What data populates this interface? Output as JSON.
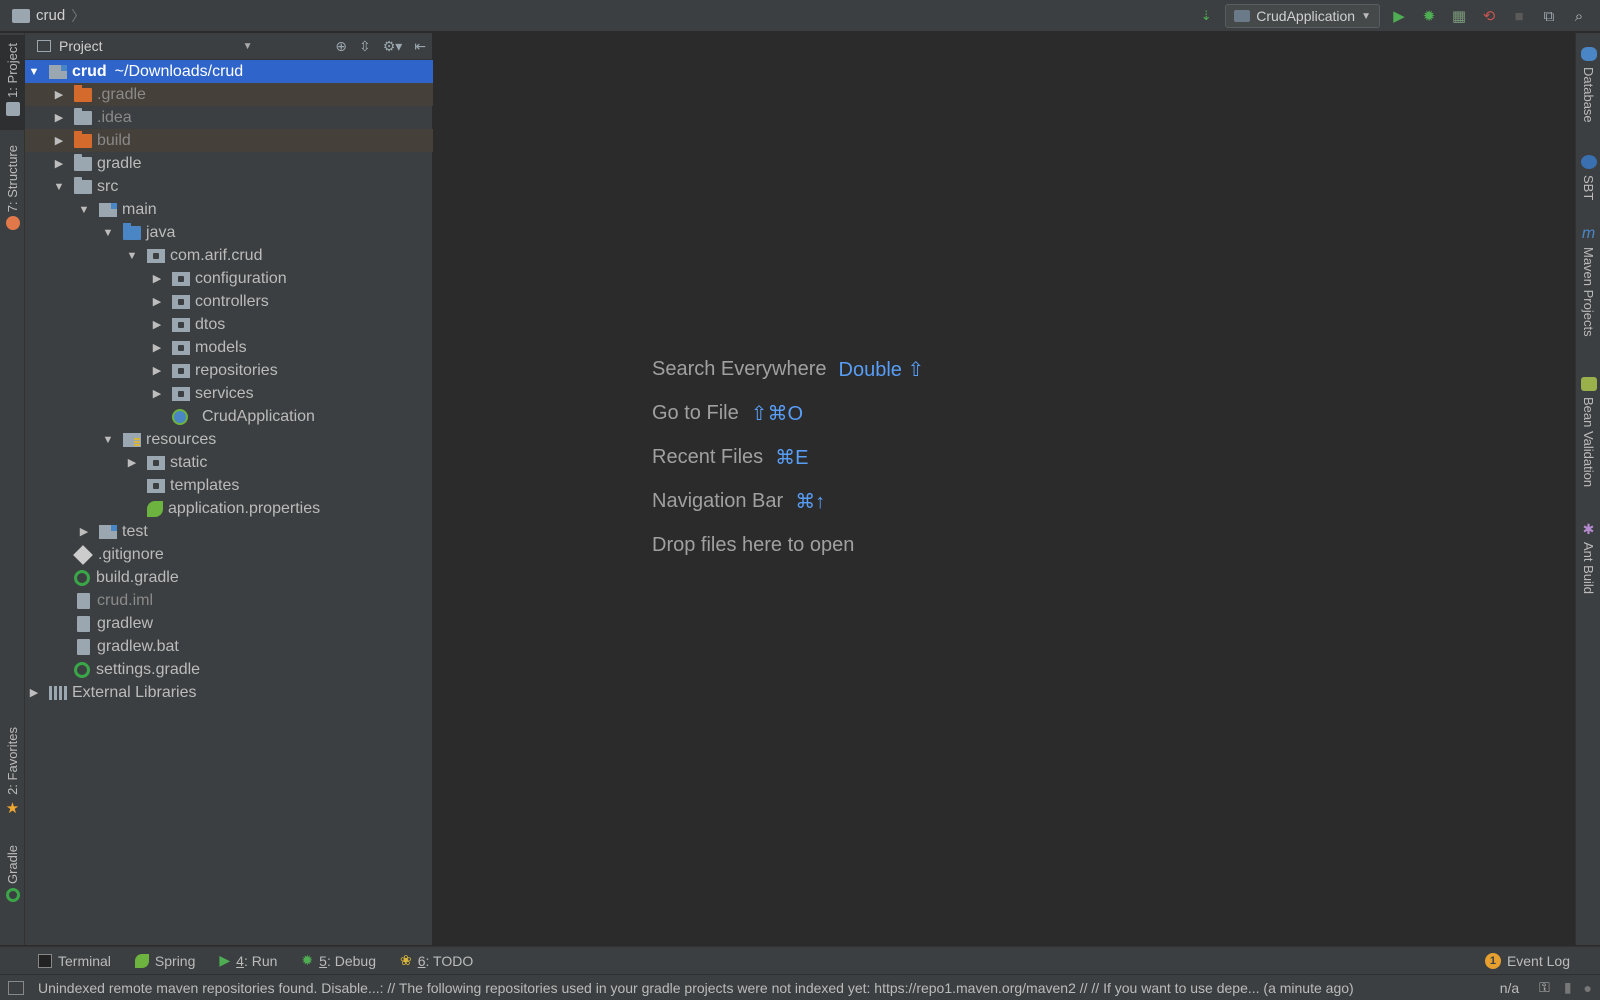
{
  "topbar": {
    "breadcrumb": "crud",
    "run_config": "CrudApplication"
  },
  "left_tabs": [
    {
      "label": "1: Project"
    },
    {
      "label": "7: Structure"
    },
    {
      "label": "2: Favorites"
    },
    {
      "label": "Gradle"
    }
  ],
  "right_tabs": [
    {
      "label": "Database"
    },
    {
      "label": "SBT"
    },
    {
      "label": "Maven Projects"
    },
    {
      "label": "Bean Validation"
    },
    {
      "label": "Ant Build"
    }
  ],
  "project_panel": {
    "title": "Project",
    "root": {
      "name": "crud",
      "path": "~/Downloads/crud"
    },
    "items": [
      {
        "label": ".gradle"
      },
      {
        "label": ".idea"
      },
      {
        "label": "build"
      },
      {
        "label": "gradle"
      },
      {
        "label": "src"
      },
      {
        "label": "main"
      },
      {
        "label": "java"
      },
      {
        "label": "com.arif.crud"
      },
      {
        "label": "configuration"
      },
      {
        "label": "controllers"
      },
      {
        "label": "dtos"
      },
      {
        "label": "models"
      },
      {
        "label": "repositories"
      },
      {
        "label": "services"
      },
      {
        "label": "CrudApplication"
      },
      {
        "label": "resources"
      },
      {
        "label": "static"
      },
      {
        "label": "templates"
      },
      {
        "label": "application.properties"
      },
      {
        "label": "test"
      },
      {
        "label": ".gitignore"
      },
      {
        "label": "build.gradle"
      },
      {
        "label": "crud.iml"
      },
      {
        "label": "gradlew"
      },
      {
        "label": "gradlew.bat"
      },
      {
        "label": "settings.gradle"
      },
      {
        "label": "External Libraries"
      }
    ]
  },
  "editor": {
    "hints": [
      {
        "label": "Search Everywhere",
        "key": "Double ⇧"
      },
      {
        "label": "Go to File",
        "key": "⇧⌘O"
      },
      {
        "label": "Recent Files",
        "key": "⌘E"
      },
      {
        "label": "Navigation Bar",
        "key": "⌘↑"
      },
      {
        "label": "Drop files here to open",
        "key": ""
      }
    ]
  },
  "bottom_tabs": {
    "terminal": "Terminal",
    "spring": "Spring",
    "run_num": "4",
    "run": ": Run",
    "debug_num": "5",
    "debug": ": Debug",
    "todo_num": "6",
    "todo": ": TODO",
    "event_log": "Event Log",
    "event_count": "1"
  },
  "status": {
    "message": "Unindexed remote maven repositories found. Disable...: // The following repositories used in your gradle projects were not indexed yet: https://repo1.maven.org/maven2 // // If you want to use depe... (a minute ago)",
    "position": "n/a"
  }
}
